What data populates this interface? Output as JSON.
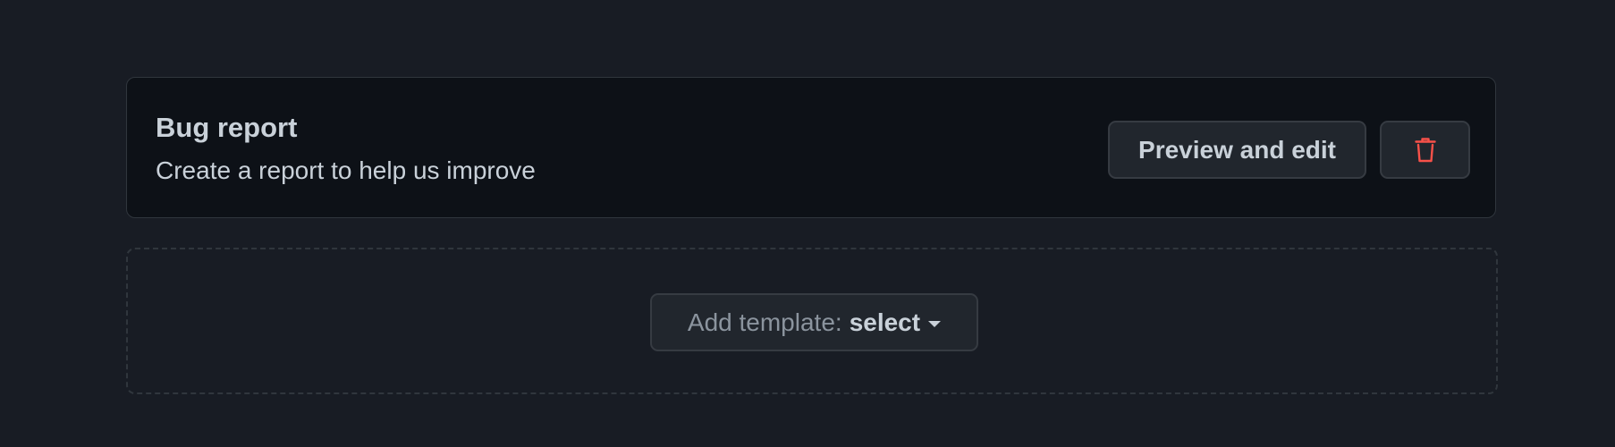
{
  "template": {
    "title": "Bug report",
    "description": "Create a report to help us improve",
    "preview_label": "Preview and edit",
    "delete_icon": "trash-icon"
  },
  "add_template": {
    "label": "Add template:",
    "value": "select",
    "icon": "caret-down-icon"
  },
  "colors": {
    "background": "#181c24",
    "card_background": "#0d1117",
    "button_background": "#21262d",
    "delete_icon_color": "#f85149"
  }
}
